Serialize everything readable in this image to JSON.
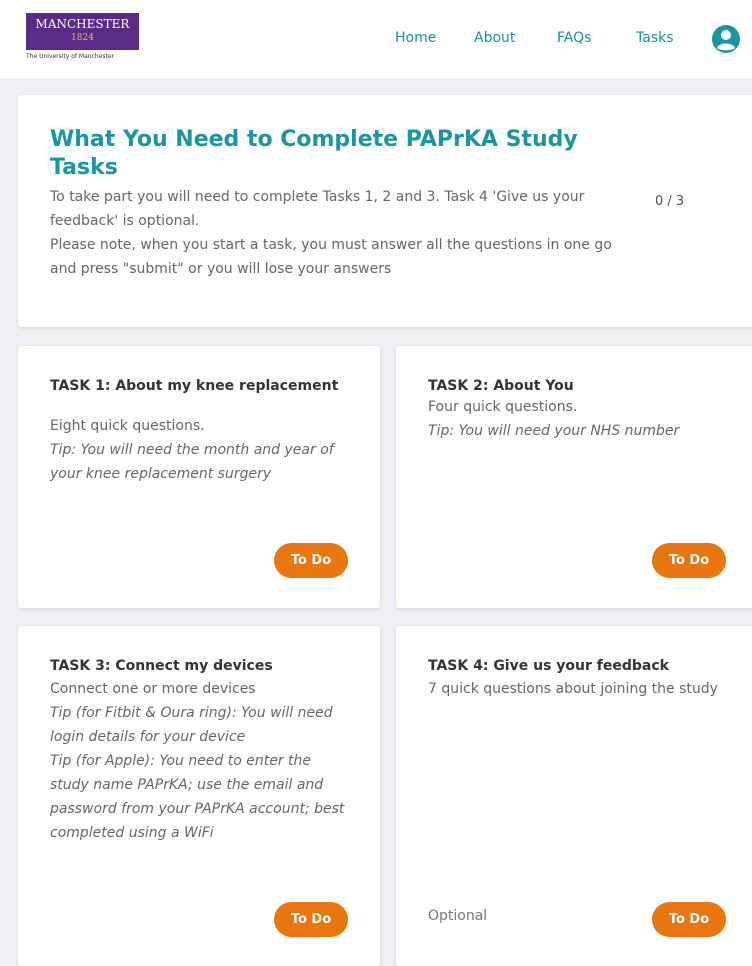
{
  "header": {
    "logo": {
      "name": "MANCHESTER",
      "year": "1824",
      "subtitle": "The University of Manchester"
    },
    "nav": [
      {
        "label": "Home"
      },
      {
        "label": "About"
      },
      {
        "label": "FAQs"
      },
      {
        "label": "Tasks"
      }
    ],
    "accent_color": "#1a95a4"
  },
  "summary": {
    "title": "What You Need to Complete PAPrKA Study Tasks",
    "line1": "To take part you will need to complete Tasks 1, 2 and 3. Task 4 'Give us your feedback' is optional.",
    "line2": "Please note, when you start a task, you must answer all the questions in one go and press \"submit\" or you will lose your answers",
    "progress": "0 / 3"
  },
  "tasks": [
    {
      "title": "TASK 1: About my knee replacement",
      "description": "Eight quick questions.",
      "tip": "Tip: You will need the month and year of your knee replacement surgery",
      "status": "To Do"
    },
    {
      "title": "TASK 2: About You",
      "description": "Four quick questions.",
      "tip": "Tip: You will need your NHS number",
      "status": "To Do"
    },
    {
      "title": "TASK 3: Connect my devices",
      "description": "Connect one or more devices",
      "tip": "Tip (for Fitbit & Oura ring): You will need login details for your device",
      "tip2": "Tip (for Apple): You need to enter the study name PAPrKA; use the email and password from your PAPrKA account; best completed using a WiFi",
      "status": "To Do"
    },
    {
      "title": "TASK 4: Give us your feedback",
      "description": "7 quick questions about joining the study",
      "note": "Optional",
      "status": "To Do"
    }
  ],
  "button_color": "#e9760f"
}
